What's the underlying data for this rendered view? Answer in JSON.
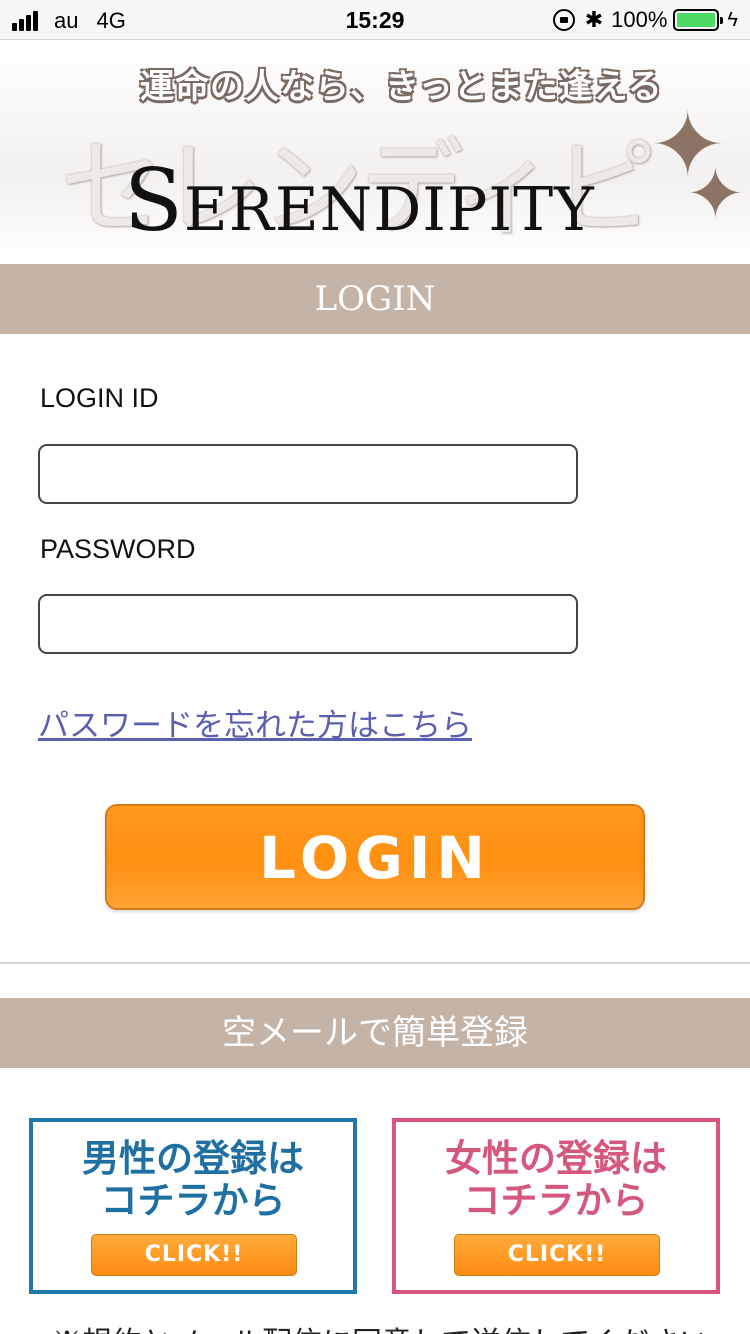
{
  "status_bar": {
    "carrier": "au",
    "network": "4G",
    "time": "15:29",
    "battery": "100%",
    "icons": [
      "signal-icon",
      "orientation-lock-icon",
      "bluetooth-icon",
      "battery-icon",
      "charging-icon"
    ]
  },
  "banner": {
    "tagline": "運命の人なら、きっとまた逢える",
    "kana_title": "セレンディピティ",
    "logo": "Serendipity"
  },
  "login_section": {
    "header": "LOGIN",
    "id_label": "LOGIN ID",
    "id_value": "",
    "password_label": "PASSWORD",
    "password_value": "",
    "forgot_link": "パスワードを忘れた方はこちら",
    "login_button": "LOGIN"
  },
  "register_section": {
    "header": "空メールで簡単登録",
    "male": {
      "line1": "男性の登録は",
      "line2": "コチラから",
      "button": "CLICK!!"
    },
    "female": {
      "line1": "女性の登録は",
      "line2": "コチラから",
      "button": "CLICK!!"
    },
    "note": "※規約とメール配信に同意して送信してください"
  },
  "colors": {
    "header_bg": "#c4b4a8",
    "accent_orange": "#ff8f10",
    "link": "#5a5fb0",
    "male_blue": "#1f78a8",
    "female_pink": "#d8557c",
    "battery_green": "#4cd964"
  }
}
